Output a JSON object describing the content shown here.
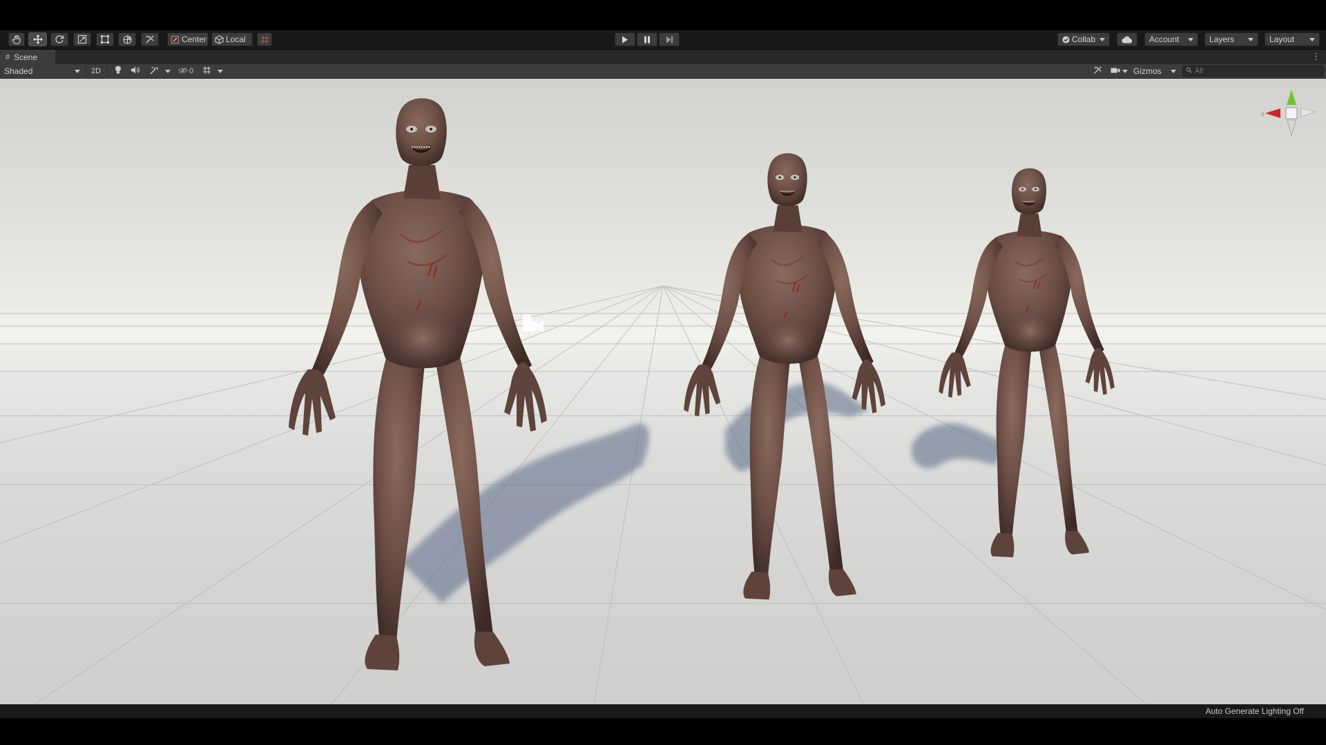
{
  "toolbar": {
    "tools": [
      {
        "name": "hand-tool",
        "icon": "hand-icon"
      },
      {
        "name": "move-tool",
        "icon": "move-icon",
        "active": true
      },
      {
        "name": "rotate-tool",
        "icon": "rotate-icon"
      },
      {
        "name": "scale-tool",
        "icon": "scale-icon"
      },
      {
        "name": "rect-tool",
        "icon": "rect-icon"
      },
      {
        "name": "transform-tool",
        "icon": "transform-icon"
      },
      {
        "name": "custom-tool",
        "icon": "wrench-icon"
      }
    ],
    "pivot_mode": "Center",
    "pivot_rotation": "Local",
    "play_controls": [
      "play-icon",
      "pause-icon",
      "step-icon"
    ],
    "collab_label": "Collab",
    "account_label": "Account",
    "layers_label": "Layers",
    "layout_label": "Layout"
  },
  "scene_tab": {
    "icon": "hash-icon",
    "label": "Scene",
    "menu_icon": "kebab-icon"
  },
  "scene_toolbar": {
    "draw_mode": "Shaded",
    "mode_2d_label": "2D",
    "hidden_count": "0",
    "gizmos_label": "Gizmos",
    "search_placeholder": "All"
  },
  "viewport": {
    "content": "three-humanoid-creatures-on-grid-floor",
    "camera_icon": "scene-camera-icon",
    "orientation_gizmo": {
      "x_color": "#c8282a",
      "y_color": "#6ac82e",
      "axis_label": "x"
    }
  },
  "status": {
    "lighting_text": "Auto Generate Lighting Off"
  },
  "colors": {
    "toolbar_bg": "#191919",
    "button_bg": "#3c3c3c",
    "scene_toolbar_bg": "#3c3c3c",
    "text": "#d2d2d2"
  }
}
